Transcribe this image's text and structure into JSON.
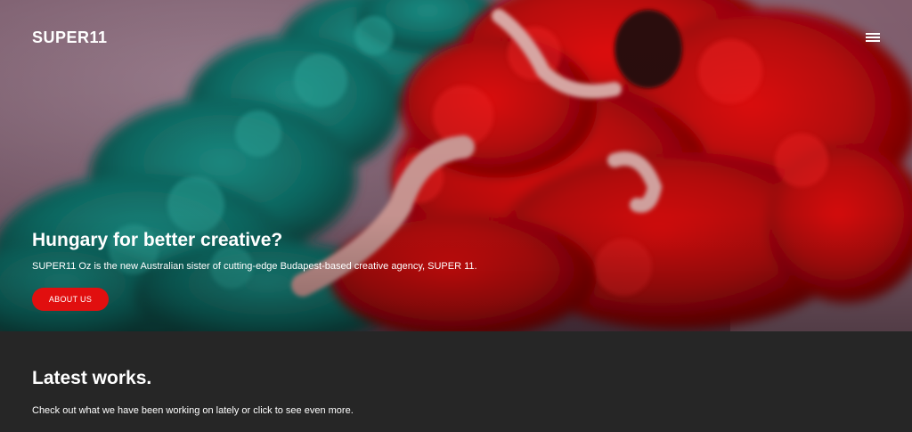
{
  "header": {
    "logo": "SUPER11",
    "menu_icon": "hamburger-menu-icon"
  },
  "hero": {
    "title": "Hungary for better creative?",
    "description": "SUPER11 Oz is the new Australian sister of cutting-edge Budapest-based creative agency, SUPER 11.",
    "button_label": "ABOUT US",
    "image_subject": "woman-in-red-and-teal-smoke"
  },
  "latest_works": {
    "title": "Latest works.",
    "description": "Check out what we have been working on lately or click to see even more."
  },
  "colors": {
    "accent": "#e10f0f",
    "dark_section": "#262626",
    "hero_bg": "#8e6f7e",
    "teal_smoke": "#0f6e66",
    "red_smoke": "#c10a0a"
  }
}
